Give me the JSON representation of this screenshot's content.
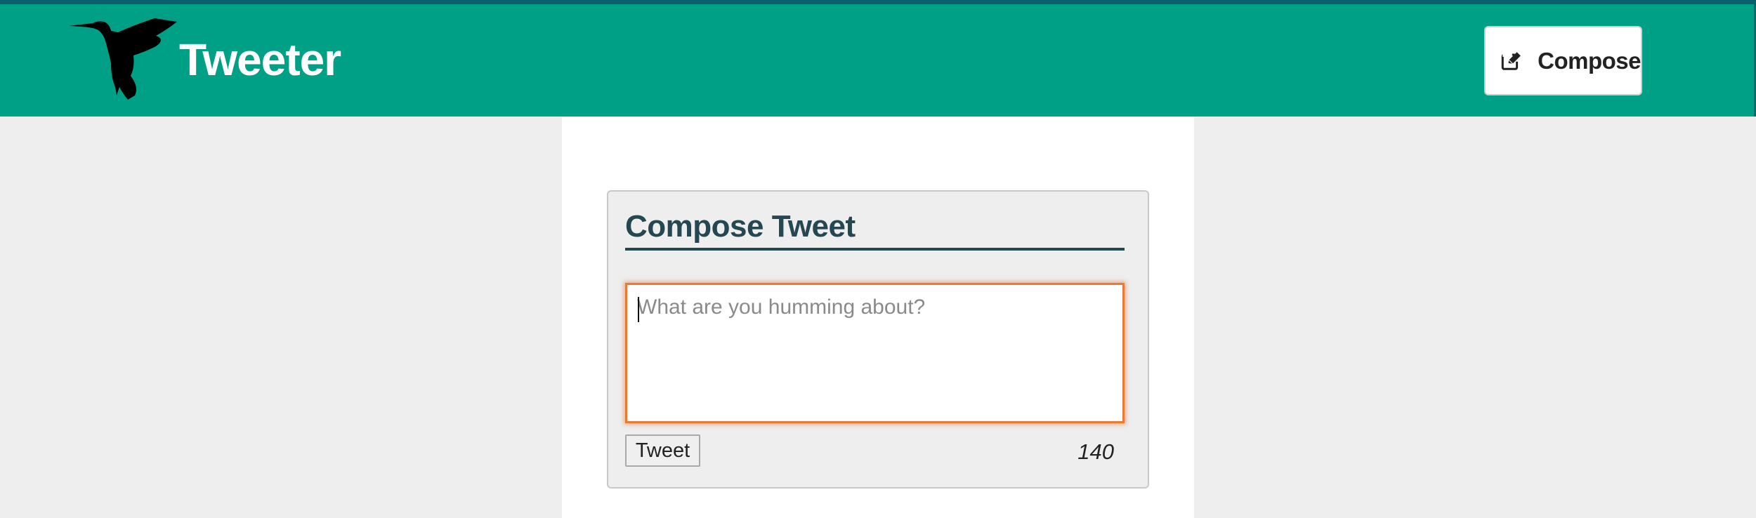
{
  "header": {
    "brand_name": "Tweeter",
    "logo_icon": "hummingbird-icon",
    "compose_icon": "edit-icon",
    "compose_label": "Compose",
    "colors": {
      "navbar": "#00a087",
      "topline": "#0b5f6b"
    }
  },
  "compose": {
    "title": "Compose Tweet",
    "placeholder": "What are you humming about?",
    "value": "",
    "submit_label": "Tweet",
    "char_counter": "140",
    "colors": {
      "title": "#244751",
      "focus_ring": "#e87a36"
    }
  }
}
